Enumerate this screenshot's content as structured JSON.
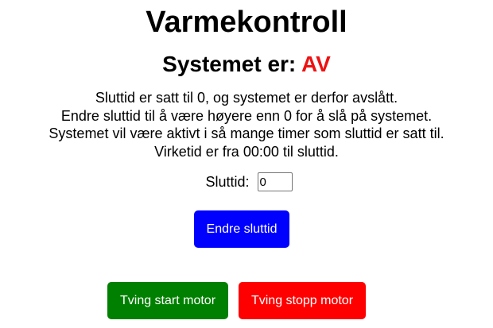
{
  "header": {
    "title": "Varmekontroll"
  },
  "status": {
    "label": "Systemet er:",
    "value": "AV",
    "value_color": "#ee1111"
  },
  "info_lines": [
    "Sluttid er satt til 0, og systemet er derfor avslått.",
    "Endre sluttid til å være høyere enn 0 for å slå på systemet.",
    "Systemet vil være aktivt i så mange timer som sluttid er satt til.",
    "Virketid er fra 00:00 til sluttid."
  ],
  "sluttid_field": {
    "label": "Sluttid:",
    "value": "0"
  },
  "buttons": {
    "change_label": "Endre sluttid",
    "change_color": "#0000ff",
    "start_label": "Tving start motor",
    "start_color": "#008000",
    "stop_label": "Tving stopp motor",
    "stop_color": "#ff0000"
  }
}
